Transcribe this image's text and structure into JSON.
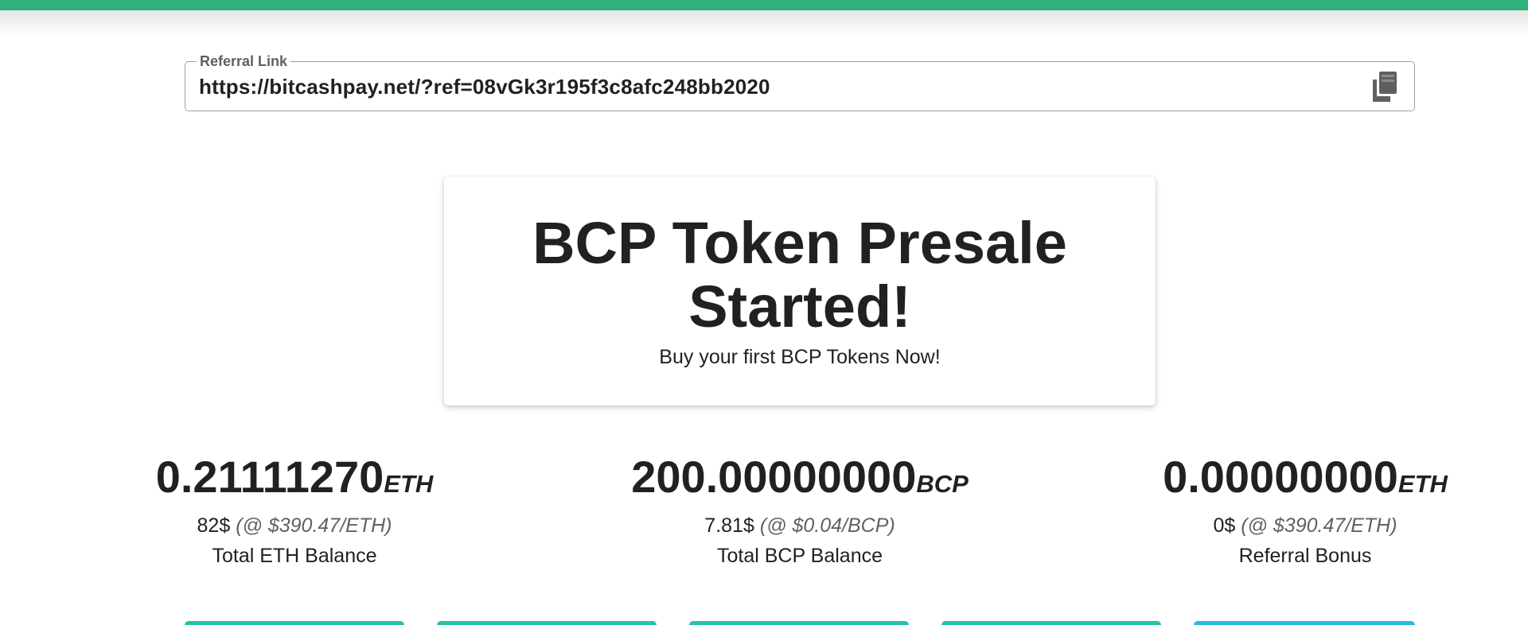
{
  "colors": {
    "accent": "#2eb17a",
    "teal": "#26c2a9",
    "blue": "#2bb7e6"
  },
  "referral": {
    "legend": "Referral Link",
    "url": "https://bitcashpay.net/?ref=08vGk3r195f3c8afc248bb2020",
    "copy_icon": "copy-icon"
  },
  "promo": {
    "title_line1": "BCP Token Presale",
    "title_line2": "Started!",
    "subtitle": "Buy your first BCP Tokens Now!"
  },
  "stats": [
    {
      "amount": "0.21111270",
      "unit": "ETH",
      "usd": "82$",
      "rate": "(@ $390.47/ETH)",
      "label": "Total ETH Balance"
    },
    {
      "amount": "200.00000000",
      "unit": "BCP",
      "usd": "7.81$",
      "rate": "(@ $0.04/BCP)",
      "label": "Total BCP Balance"
    },
    {
      "amount": "0.00000000",
      "unit": "ETH",
      "usd": "0$",
      "rate": "(@ $390.47/ETH)",
      "label": "Referral Bonus"
    }
  ]
}
